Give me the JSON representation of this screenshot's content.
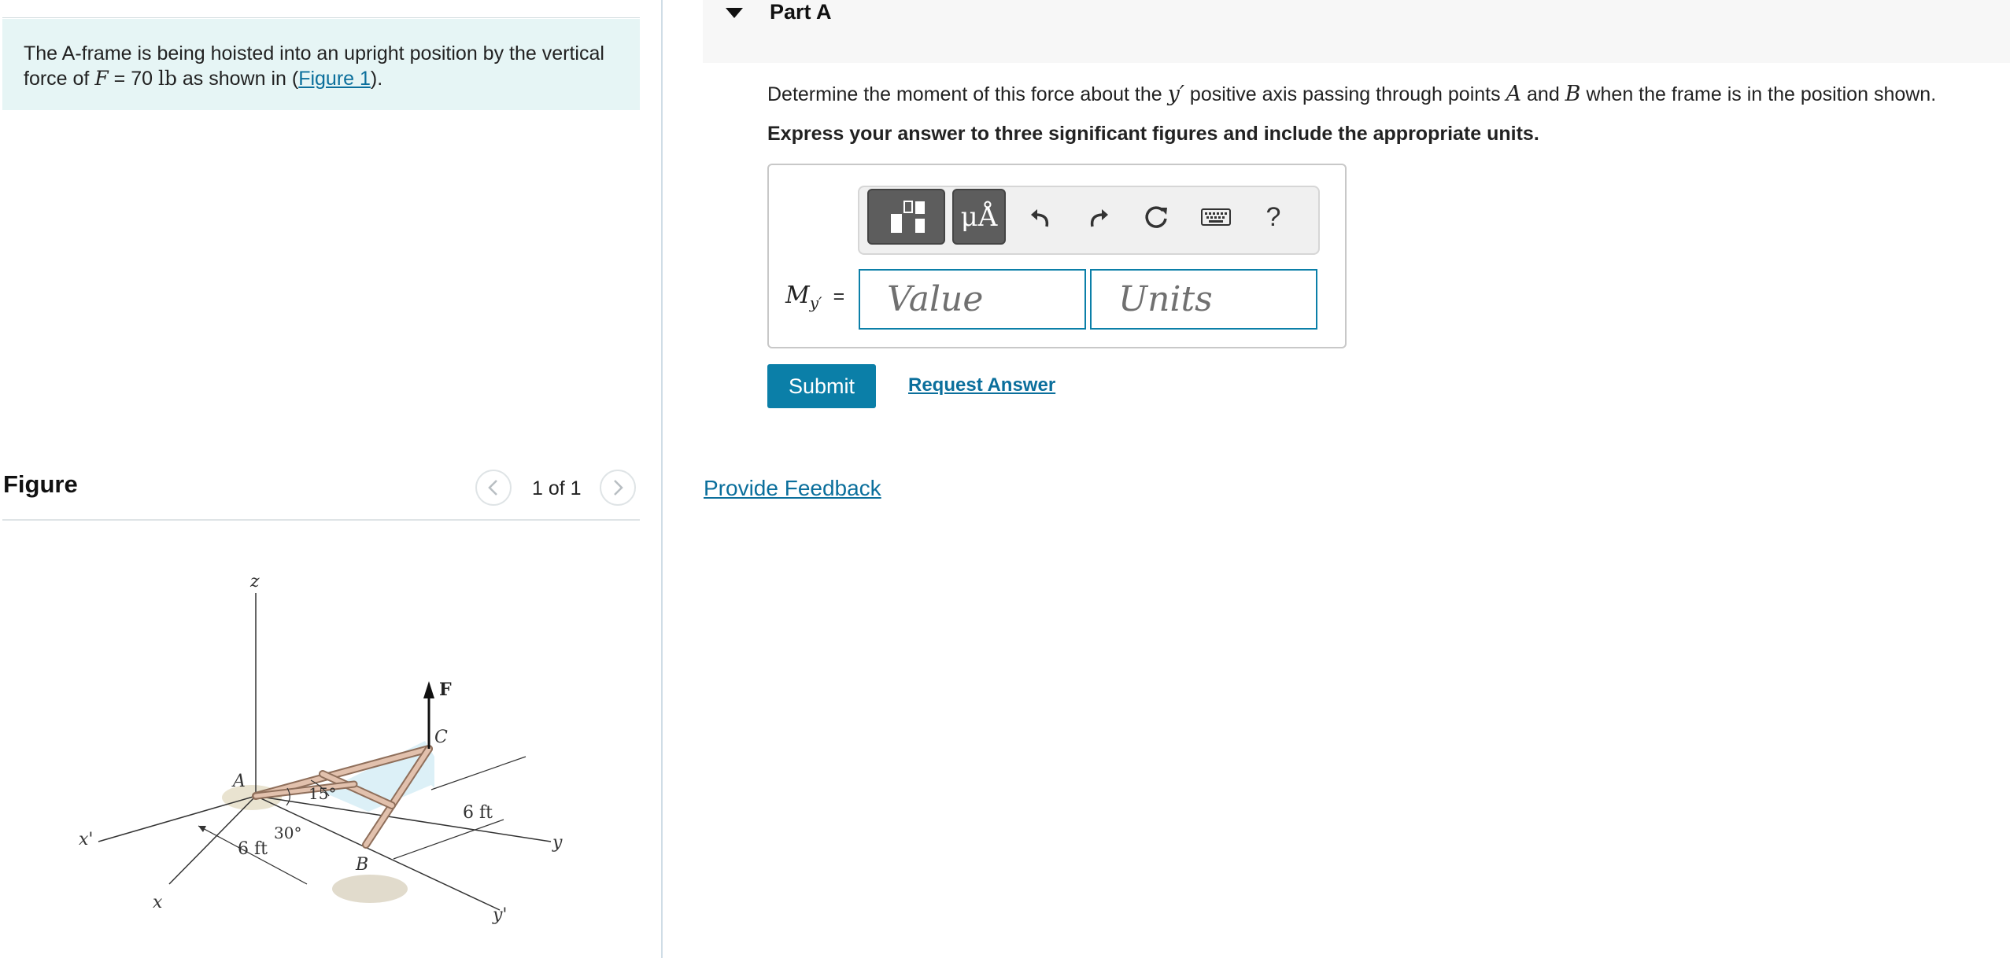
{
  "problem": {
    "text_before": "The A-frame is being hoisted into an upright position by the vertical force of ",
    "var_F": "F",
    "equals": " = ",
    "value": "70",
    "unit": "lb",
    "text_middle": " as shown in (",
    "figure_link": "Figure 1",
    "text_after": ")."
  },
  "figure_panel": {
    "title": "Figure",
    "counter": "1 of 1",
    "labels": {
      "z": "z",
      "F": "F",
      "C": "C",
      "A": "A",
      "angle_15": "15°",
      "angle_30": "30°",
      "six_ft_right": "6 ft",
      "six_ft_left": "6 ft",
      "x_prime": "x'",
      "y": "y",
      "B": "B",
      "x": "x",
      "y_prime": "y'"
    }
  },
  "part_a": {
    "title": "Part A",
    "question_before": "Determine the moment of this force about the ",
    "question_axis": "y′",
    "question_middle": " positive axis passing through points ",
    "point_A": "A",
    "and": " and ",
    "point_B": "B",
    "question_after": " when the frame is in the position shown.",
    "instruction": "Express your answer to three significant figures and include the appropriate units."
  },
  "answer": {
    "label_M": "M",
    "label_sub": "y′",
    "equals": "=",
    "value_placeholder": "Value",
    "units_placeholder": "Units"
  },
  "toolbar": {
    "templates_icon": "templates-icon",
    "units_symbols": "μÅ",
    "undo_icon": "undo-icon",
    "redo_icon": "redo-icon",
    "reset_icon": "reset-icon",
    "keyboard_icon": "keyboard-icon",
    "help": "?"
  },
  "actions": {
    "submit": "Submit",
    "request_answer": "Request Answer"
  },
  "feedback_link": "Provide Feedback",
  "colors": {
    "accent": "#0b7fa8",
    "link": "#0b6f9c",
    "problem_bg": "#e6f5f5"
  }
}
